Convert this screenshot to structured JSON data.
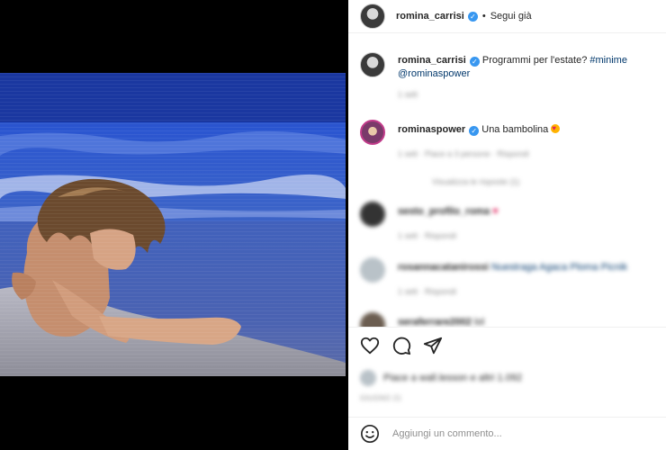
{
  "post": {
    "author": "romina_carrisi",
    "follow_status": "Segui già",
    "caption_user": "romina_carrisi",
    "caption_text": "Programmi per l'estate?",
    "caption_hashtag": "#minime",
    "caption_mention": "@rominaspower",
    "caption_time": "1 sett"
  },
  "comments": [
    {
      "user": "rominaspower",
      "text": "Una bambolina",
      "meta": "1 sett  ·  Piace a 3 persone  ·  Rispondi",
      "replies": "Visualizza le risposte (1)"
    },
    {
      "user": "sesto_profilo_roma",
      "text": "",
      "meta": "1 sett  ·  Rispondi"
    },
    {
      "user": "rosannacatanirossi",
      "text": "Nuestraga Agaca Ploma Picnik",
      "meta": "1 sett  ·  Rispondi"
    },
    {
      "user": "seraferrare2002",
      "text": "lol"
    }
  ],
  "likes": {
    "text": "Piace a wall.lesson e altri 1.092"
  },
  "date": "GIUGNO 21",
  "add_comment": {
    "placeholder": "Aggiungi un commento..."
  }
}
